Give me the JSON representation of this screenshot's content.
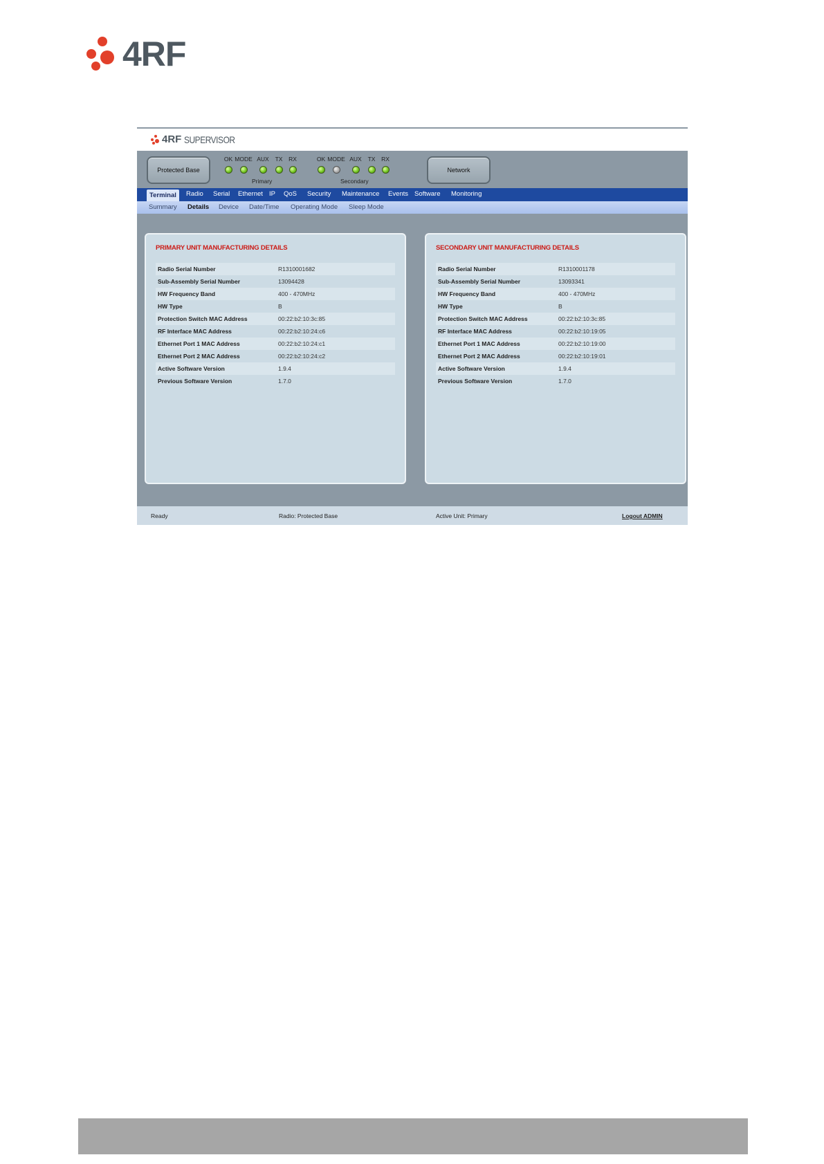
{
  "doc": {
    "logo_text": "4RF"
  },
  "app": {
    "logo_text": "4RF",
    "product": "SUPERVISOR",
    "primary_button": "Protected Base",
    "network_button": "Network",
    "led_labels": [
      "OK",
      "MODE",
      "AUX",
      "TX",
      "RX"
    ],
    "primary_label": "Primary",
    "secondary_label": "Secondary",
    "led_colors": {
      "on": "#6fc21e",
      "off": "#a8a8a8"
    }
  },
  "nav": {
    "tabs": [
      "Terminal",
      "Radio",
      "Serial",
      "Ethernet",
      "IP",
      "QoS",
      "Security",
      "Maintenance",
      "Events",
      "Software",
      "Monitoring"
    ],
    "active_tab": "Terminal",
    "subtabs": [
      "Summary",
      "Details",
      "Device",
      "Date/Time",
      "Operating Mode",
      "Sleep Mode"
    ],
    "active_subtab": "Details"
  },
  "primary": {
    "title": "PRIMARY UNIT MANUFACTURING DETAILS",
    "rows": [
      {
        "label": "Radio Serial Number",
        "value": "R1310001682"
      },
      {
        "label": "Sub-Assembly Serial Number",
        "value": "13094428"
      },
      {
        "label": "HW Frequency Band",
        "value": "400 - 470MHz"
      },
      {
        "label": "HW Type",
        "value": "B"
      },
      {
        "label": "Protection Switch MAC Address",
        "value": "00:22:b2:10:3c:85"
      },
      {
        "label": "RF Interface MAC Address",
        "value": "00:22:b2:10:24:c6"
      },
      {
        "label": "Ethernet Port 1 MAC Address",
        "value": "00:22:b2:10:24:c1"
      },
      {
        "label": "Ethernet Port 2 MAC Address",
        "value": "00:22:b2:10:24:c2"
      },
      {
        "label": "Active Software Version",
        "value": "1.9.4"
      },
      {
        "label": "Previous Software Version",
        "value": "1.7.0"
      }
    ]
  },
  "secondary": {
    "title": "SECONDARY UNIT MANUFACTURING DETAILS",
    "rows": [
      {
        "label": "Radio Serial Number",
        "value": "R1310001178"
      },
      {
        "label": "Sub-Assembly Serial Number",
        "value": "13093341"
      },
      {
        "label": "HW Frequency Band",
        "value": "400 - 470MHz"
      },
      {
        "label": "HW Type",
        "value": "B"
      },
      {
        "label": "Protection Switch MAC Address",
        "value": "00:22:b2:10:3c:85"
      },
      {
        "label": "RF Interface MAC Address",
        "value": "00:22:b2:10:19:05"
      },
      {
        "label": "Ethernet Port 1 MAC Address",
        "value": "00:22:b2:10:19:00"
      },
      {
        "label": "Ethernet Port 2 MAC Address",
        "value": "00:22:b2:10:19:01"
      },
      {
        "label": "Active Software Version",
        "value": "1.9.4"
      },
      {
        "label": "Previous Software Version",
        "value": "1.7.0"
      }
    ]
  },
  "footer": {
    "status": "Ready",
    "radio": "Radio: Protected Base",
    "active_unit": "Active Unit: Primary",
    "logout": "Logout ADMIN"
  }
}
